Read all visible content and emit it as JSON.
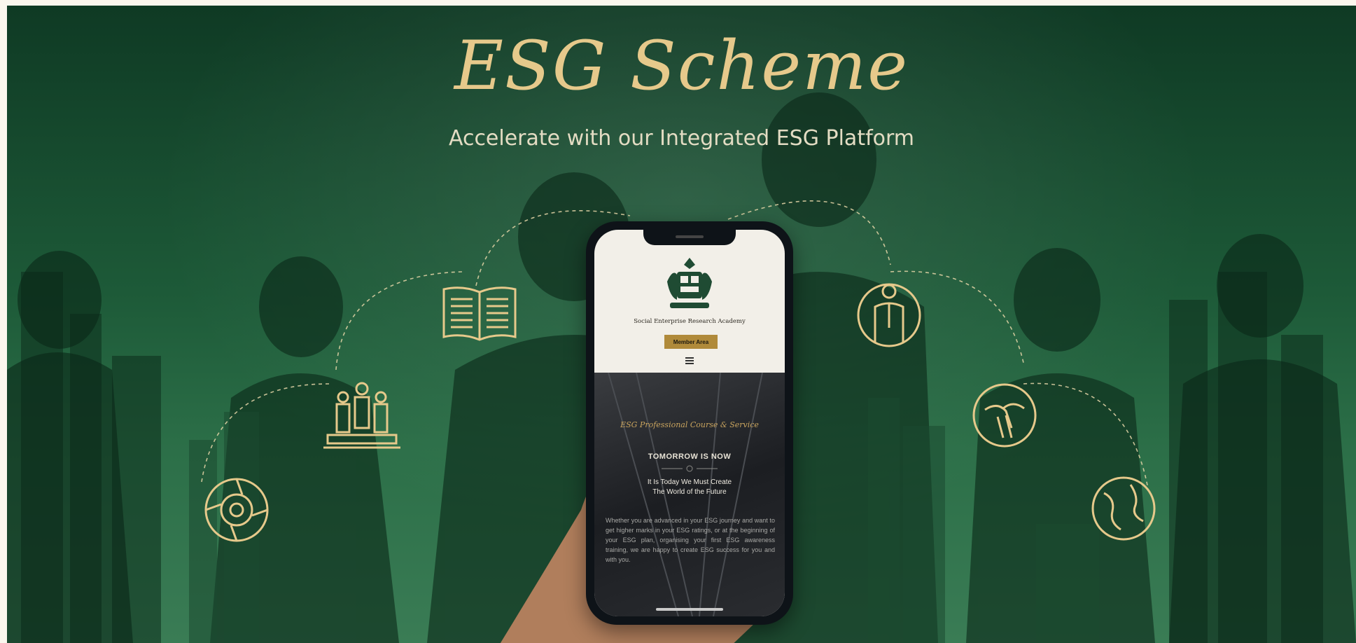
{
  "banner": {
    "title": "ESG Scheme",
    "subtitle": "Accelerate with our Integrated ESG Platform",
    "colors": {
      "gold": "#e6c98b",
      "green_dark": "#0f3a24",
      "green_light": "#3a7c55"
    },
    "icons": [
      "compass-icon",
      "people-podium-icon",
      "open-book-icon",
      "businessman-globe-icon",
      "handshake-hands-icon",
      "earth-globe-icon"
    ]
  },
  "phone": {
    "org_name": "Social Enterprise Research Academy",
    "member_button": "Member Area",
    "hero_script": "ESG Professional Course & Service",
    "hero_heading": "TOMORROW IS NOW",
    "hero_sub_line1": "It Is Today We Must Create",
    "hero_sub_line2": "The World of the Future",
    "hero_body": "Whether you are advanced in your ESG journey and want to get higher marks in your ESG ratings, or at the beginning of your ESG plan, organising your first ESG awareness training, we are happy to create ESG success for you and with you."
  }
}
